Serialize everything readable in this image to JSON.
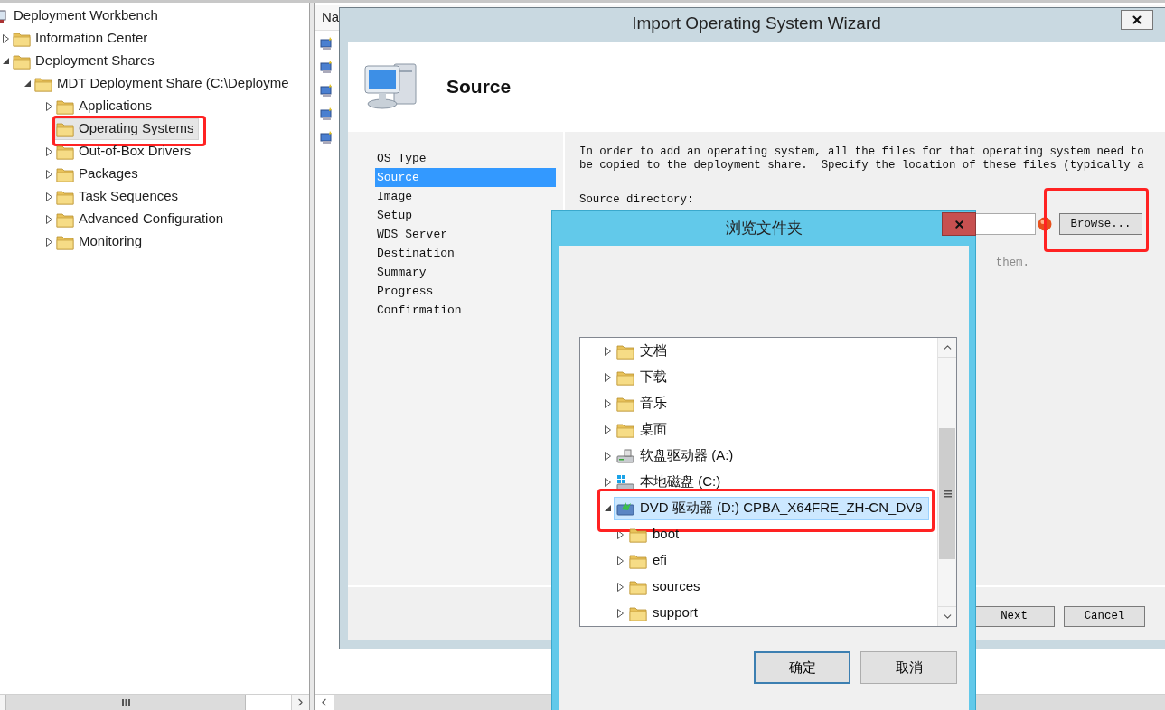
{
  "console_tree": {
    "items": [
      {
        "label": "Deployment Workbench",
        "kind": "root",
        "selected": false,
        "children": [
          {
            "label": "Information Center",
            "kind": "folder",
            "expanded": false,
            "selected": false
          },
          {
            "label": "Deployment Shares",
            "kind": "folder",
            "expanded": true,
            "selected": false,
            "children": [
              {
                "label": "MDT Deployment Share (C:\\Deployme",
                "kind": "folder",
                "expanded": true,
                "selected": false,
                "children": [
                  {
                    "label": "Applications",
                    "kind": "folder",
                    "expanded": false,
                    "selected": false
                  },
                  {
                    "label": "Operating Systems",
                    "kind": "folder",
                    "selected": true,
                    "annotated": true
                  },
                  {
                    "label": "Out-of-Box Drivers",
                    "kind": "folder",
                    "expanded": false,
                    "selected": false
                  },
                  {
                    "label": "Packages",
                    "kind": "folder",
                    "expanded": false,
                    "selected": false
                  },
                  {
                    "label": "Task Sequences",
                    "kind": "folder",
                    "expanded": false,
                    "selected": false
                  },
                  {
                    "label": "Advanced Configuration",
                    "kind": "folder",
                    "expanded": false,
                    "selected": false
                  },
                  {
                    "label": "Monitoring",
                    "kind": "folder",
                    "expanded": false,
                    "selected": false
                  }
                ]
              }
            ]
          }
        ]
      }
    ]
  },
  "list_pane": {
    "header": "Na",
    "rows": [
      {
        "kind": "os-image"
      },
      {
        "kind": "os-image"
      },
      {
        "kind": "os-image"
      },
      {
        "kind": "os-image"
      },
      {
        "kind": "os-image"
      }
    ]
  },
  "wizard": {
    "title": "Import Operating System Wizard",
    "page_title": "Source",
    "steps": [
      {
        "label": "OS Type",
        "selected": false
      },
      {
        "label": "Source",
        "selected": true
      },
      {
        "label": "Image",
        "selected": false
      },
      {
        "label": "Setup",
        "selected": false
      },
      {
        "label": "WDS Server",
        "selected": false
      },
      {
        "label": "Destination",
        "selected": false
      },
      {
        "label": "Summary",
        "selected": false
      },
      {
        "label": "Progress",
        "selected": false
      },
      {
        "label": "Confirmation",
        "selected": false
      }
    ],
    "description_lines": [
      "In order to add an operating system, all the files for that operating system need to",
      "be copied to the deployment share.  Specify the location of these files (typically a"
    ],
    "source_label": "Source directory:",
    "browse_button": {
      "label": "Browse...",
      "annotated": true
    },
    "hint_fragment": "them.",
    "buttons": [
      "Next",
      "Cancel"
    ]
  },
  "folder_dialog": {
    "title": "浏览文件夹",
    "tree": [
      {
        "label": "文档",
        "kind": "folder",
        "expanded": false,
        "selected": false
      },
      {
        "label": "下载",
        "kind": "folder",
        "expanded": false,
        "selected": false
      },
      {
        "label": "音乐",
        "kind": "folder",
        "expanded": false,
        "selected": false
      },
      {
        "label": "桌面",
        "kind": "folder",
        "expanded": false,
        "selected": false
      },
      {
        "label": "软盘驱动器 (A:)",
        "kind": "floppy-drive",
        "expanded": false,
        "selected": false
      },
      {
        "label": "本地磁盘 (C:)",
        "kind": "local-disk",
        "expanded": false,
        "selected": false
      },
      {
        "label": "DVD 驱动器 (D:) CPBA_X64FRE_ZH-CN_DV9",
        "kind": "dvd-drive",
        "expanded": true,
        "selected": true,
        "annotated": true,
        "children": [
          {
            "label": "boot",
            "kind": "folder",
            "expanded": false,
            "selected": false
          },
          {
            "label": "efi",
            "kind": "folder",
            "expanded": false,
            "selected": false
          },
          {
            "label": "sources",
            "kind": "folder",
            "expanded": false,
            "selected": false
          },
          {
            "label": "support",
            "kind": "folder",
            "expanded": false,
            "selected": false
          }
        ]
      }
    ],
    "buttons": [
      {
        "label": "确定",
        "default": true
      },
      {
        "label": "取消",
        "default": false
      }
    ]
  }
}
